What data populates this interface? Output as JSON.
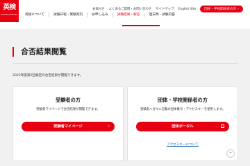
{
  "header": {
    "logo": {
      "mark": "英検",
      "sub": "EIKEN GRADES"
    },
    "utility": {
      "news": "お知らせ",
      "faq": "よくあるご質問・お問い合わせ",
      "sitemap": "サイトマップ",
      "english": "English Site",
      "group_cta": "団体・学校関係者の方"
    },
    "nav": [
      "英検について",
      "試験日程・受験案内",
      "お申し込み",
      "試験結果・解答",
      "過去問・試験内容"
    ]
  },
  "page": {
    "title": "合否結果閲覧",
    "intro": "2023年度第2回検定の合否結果が閲覧できます。"
  },
  "cards": {
    "examinee": {
      "heading": "受験者の方",
      "desc": "受験者マイページで合否結果が閲覧できます。",
      "button": "受験者マイページ"
    },
    "group": {
      "heading": "団体・学校関係者の方",
      "desc": "受験者ハガキに記載の団体番号・アクセスキーを使用します。",
      "button": "団体ポータル",
      "link": "アクセスキーについて"
    }
  },
  "colors": {
    "accent": "#e60012",
    "link": "#1a5fb4",
    "background": "#f1f1f1"
  }
}
